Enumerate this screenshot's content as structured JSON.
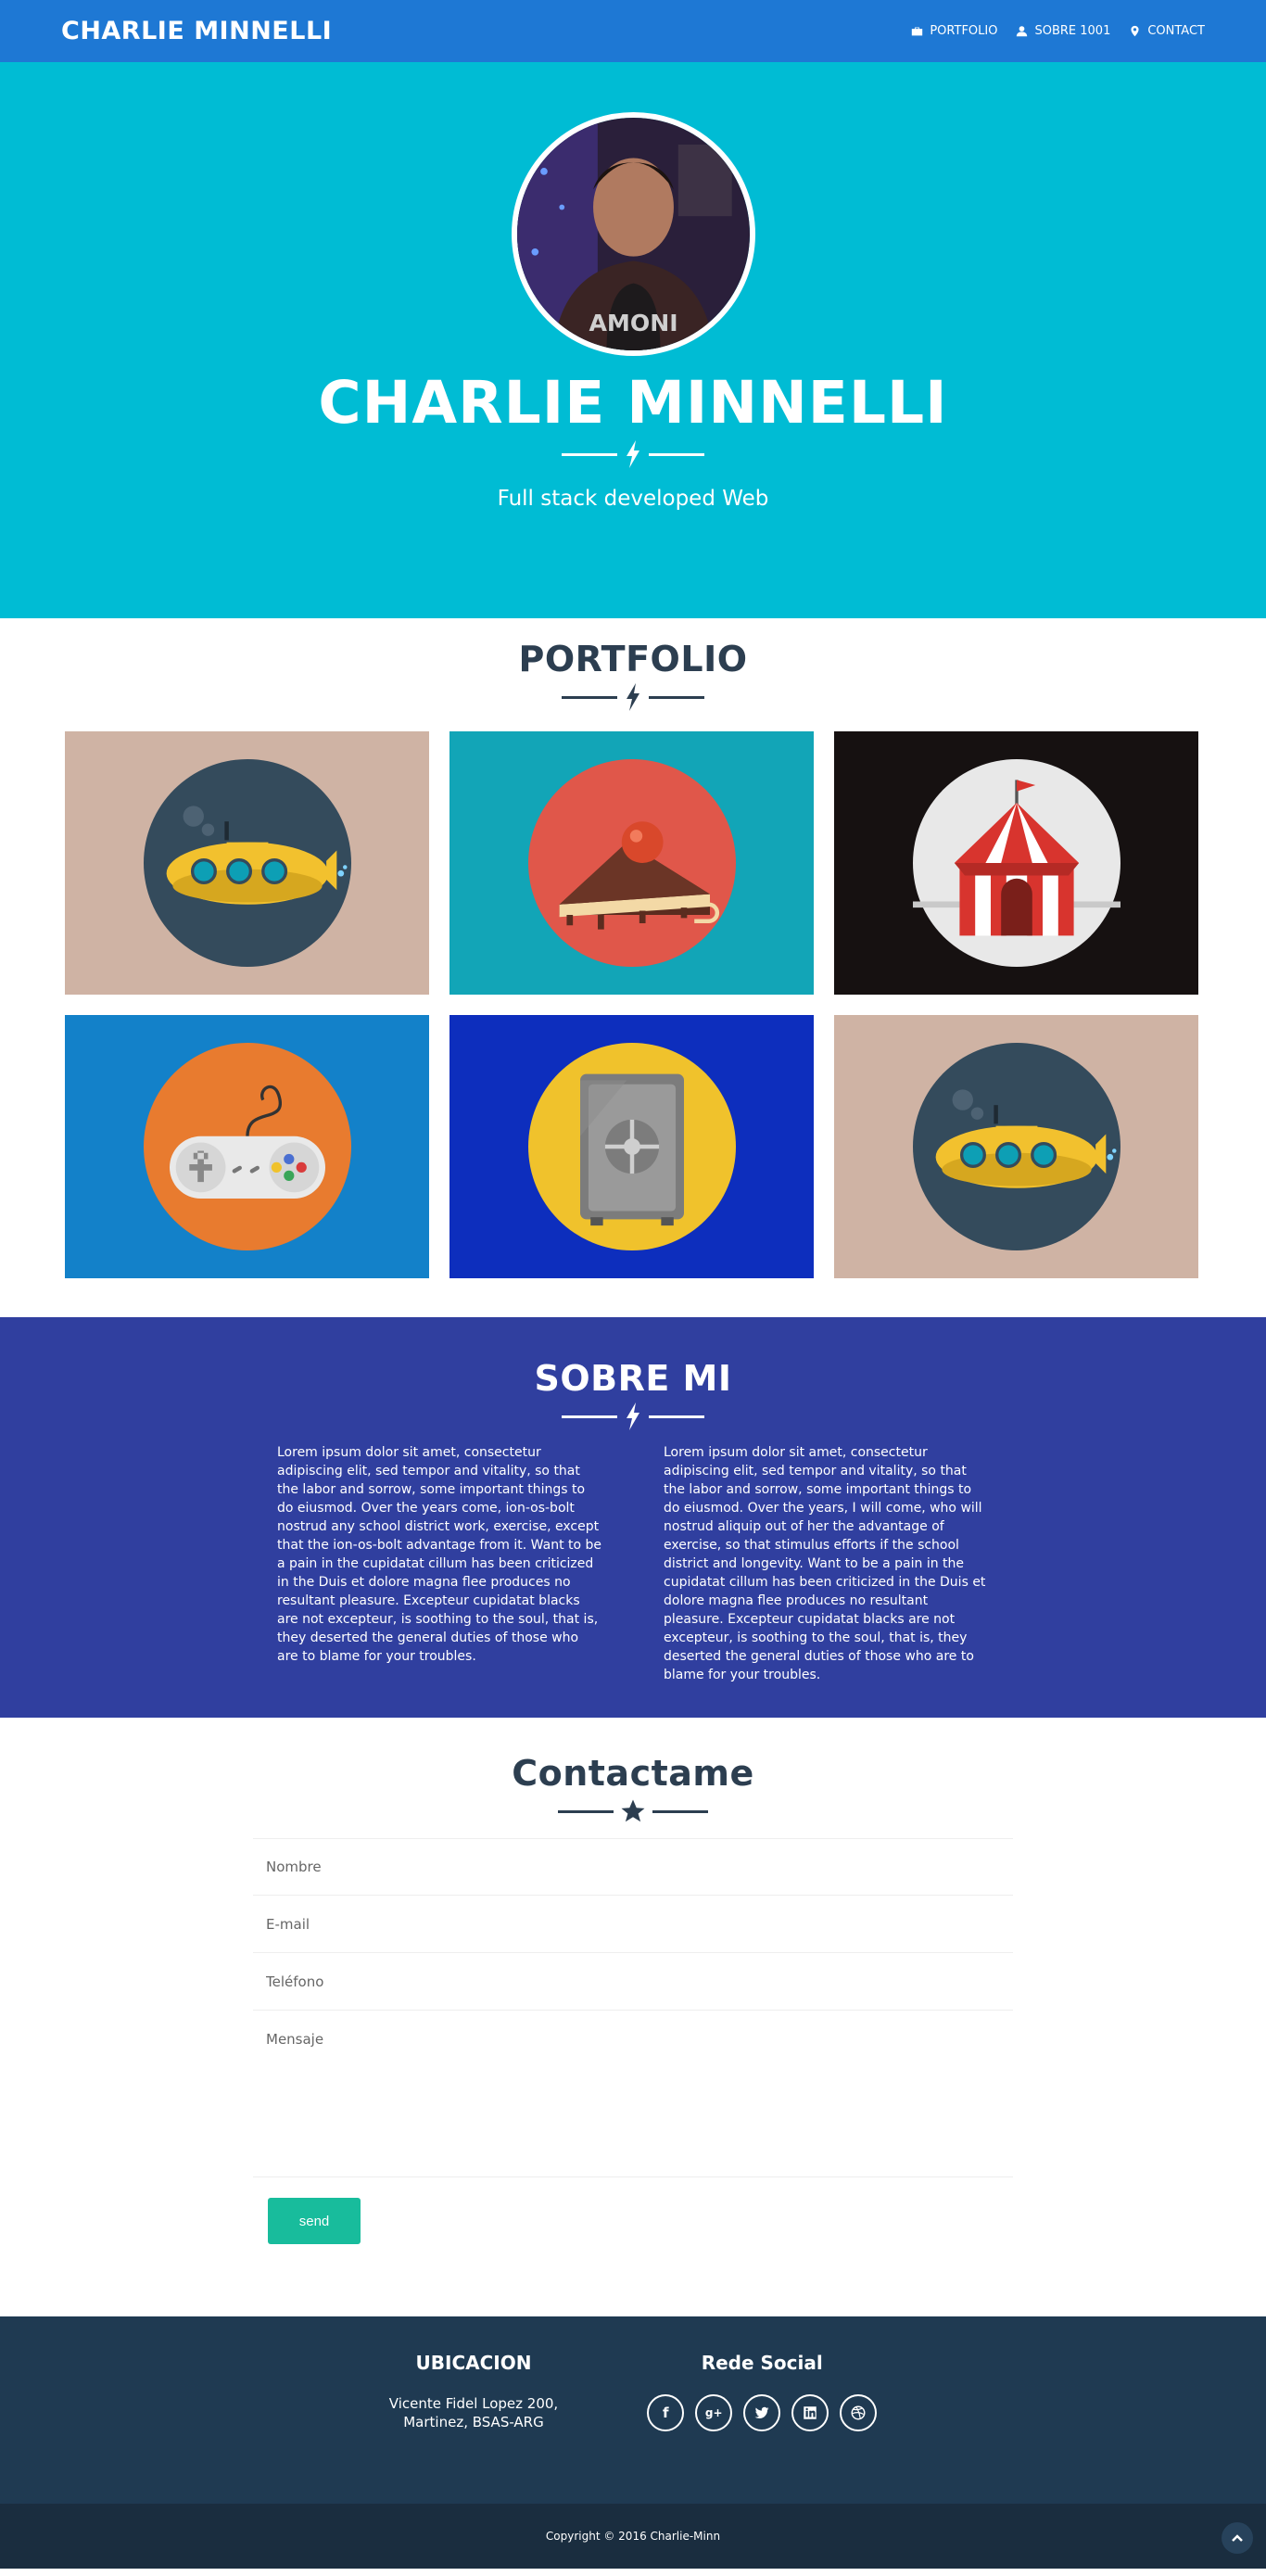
{
  "nav": {
    "brand": "CHARLIE MINNELLI",
    "links": [
      {
        "label": "PORTFOLIO",
        "icon": "briefcase-icon"
      },
      {
        "label": "SOBRE 1001",
        "icon": "user-icon"
      },
      {
        "label": "CONTACT",
        "icon": "map-marker-icon"
      }
    ]
  },
  "hero": {
    "name": "CHARLIE MINNELLI",
    "subtitle": "Full stack developed Web"
  },
  "portfolio": {
    "title": "PORTFOLIO",
    "items": [
      {
        "name": "submarine",
        "bg": "#cfb3a4"
      },
      {
        "name": "cake",
        "bg": "#12a5b7"
      },
      {
        "name": "circus-tent",
        "bg": "#161111"
      },
      {
        "name": "game-controller",
        "bg": "#1381c9"
      },
      {
        "name": "safe",
        "bg": "#0d2ebd"
      },
      {
        "name": "submarine",
        "bg": "#cfb3a4"
      }
    ]
  },
  "about": {
    "title": "SOBRE MI",
    "col1": "Lorem ipsum dolor sit amet, consectetur adipiscing elit, sed tempor and vitality, so that the labor and sorrow, some important things to do eiusmod. Over the years come, ion-os-bolt nostrud any school district work, exercise, except that the ion-os-bolt advantage from it. Want to be a pain in the cupidatat cillum has been criticized in the Duis et dolore magna flee produces no resultant pleasure. Excepteur cupidatat blacks are not excepteur, is soothing to the soul, that is, they deserted the general duties of those who are to blame for your troubles.",
    "col2": "Lorem ipsum dolor sit amet, consectetur adipiscing elit, sed tempor and vitality, so that the labor and sorrow, some important things to do eiusmod. Over the years, I will come, who will nostrud aliquip out of her the advantage of exercise, so that stimulus efforts if the school district and longevity. Want to be a pain in the cupidatat cillum has been criticized in the Duis et dolore magna flee produces no resultant pleasure. Excepteur cupidatat blacks are not excepteur, is soothing to the soul, that is, they deserted the general duties of those who are to blame for your troubles."
  },
  "contact": {
    "title": "Contactame",
    "name_placeholder": "Nombre",
    "email_placeholder": "E-mail",
    "phone_placeholder": "Teléfono",
    "message_placeholder": "Mensaje",
    "send_label": "send"
  },
  "footer": {
    "location_title": "UBICACION",
    "address_line1": "Vicente Fidel Lopez 200,",
    "address_line2": "Martinez, BSAS-ARG",
    "social_title": "Rede Social",
    "socials": [
      "facebook-icon",
      "google-plus-icon",
      "twitter-icon",
      "linkedin-icon",
      "dribbble-icon"
    ],
    "copyright": "Copyright © 2016 Charlie-Minn"
  },
  "colors": {
    "nav": "#1e78d4",
    "hero": "#00bcd4",
    "about": "#303f9f",
    "footer": "#1f3a52",
    "footer_bottom": "#1a2d3f",
    "send_button": "#18bc9c"
  }
}
